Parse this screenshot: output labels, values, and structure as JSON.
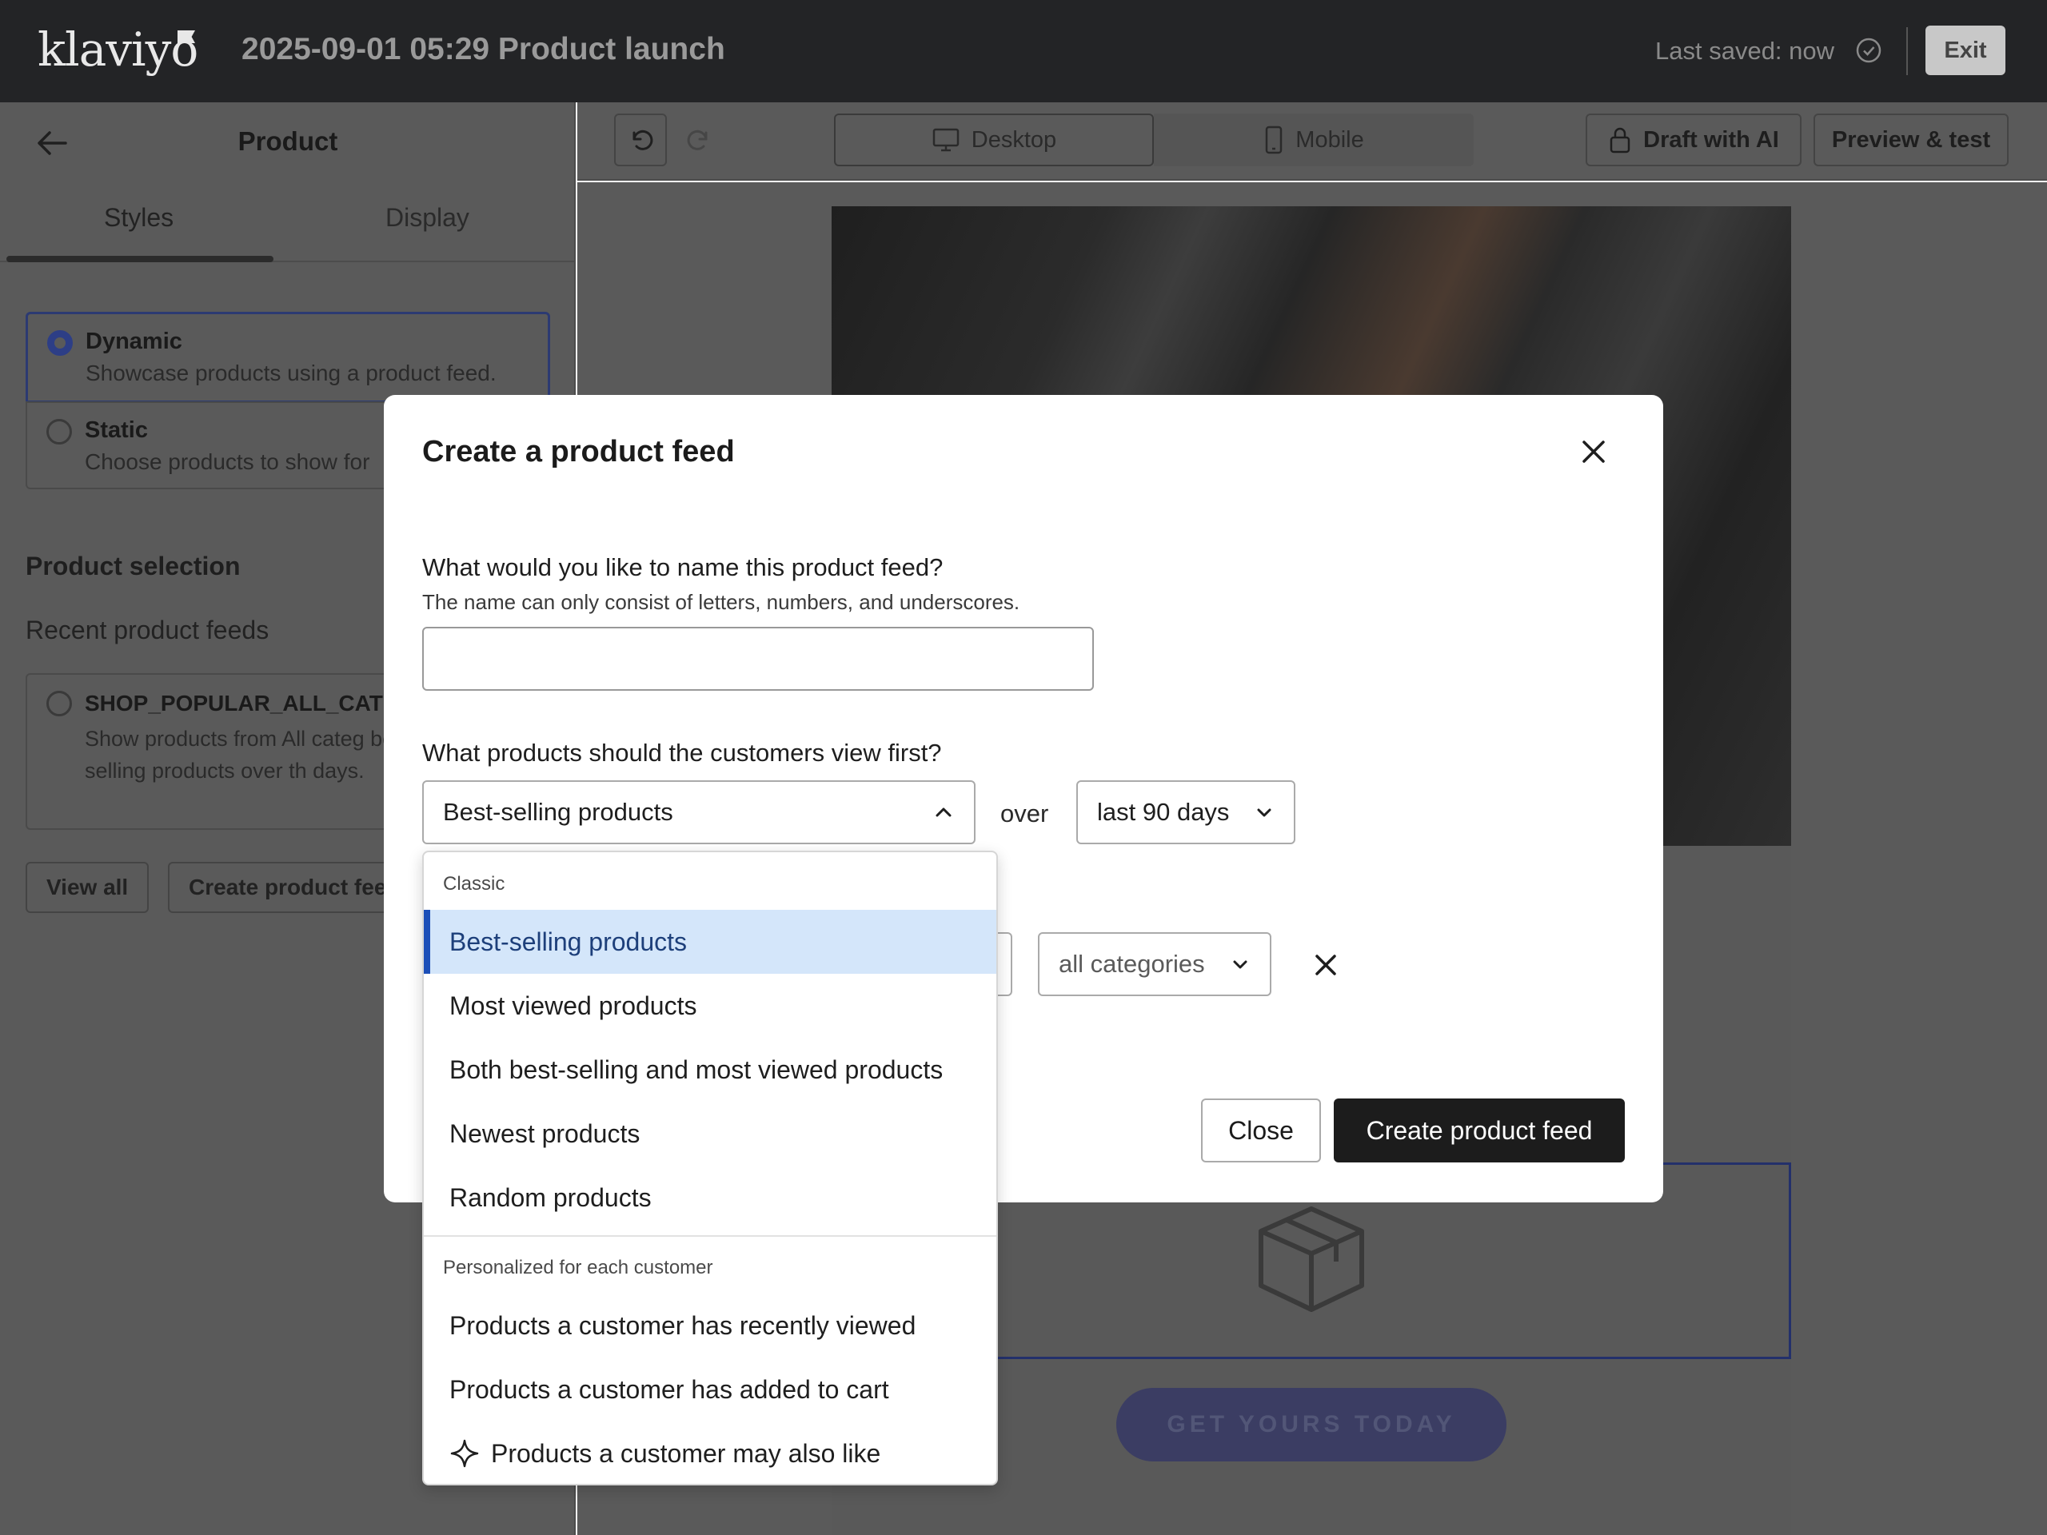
{
  "app": {
    "logo_text": "klaviyo",
    "document_title": "2025-09-01 05:29 Product launch",
    "last_saved": "Last saved: now",
    "exit_label": "Exit"
  },
  "left_panel": {
    "title": "Product",
    "tabs": [
      "Styles",
      "Display"
    ],
    "active_tab": "Styles",
    "options": [
      {
        "title": "Dynamic",
        "desc": "Showcase products using a product feed.",
        "selected": true
      },
      {
        "title": "Static",
        "desc": "Choose products to show for",
        "selected": false
      }
    ],
    "section_title": "Product selection",
    "recent_label": "Recent product feeds",
    "feed_card": {
      "title": "SHOP_POPULAR_ALL_CATE",
      "desc": "Show products from All categ best-selling products over th days."
    },
    "view_all_label": "View all",
    "create_feed_label": "Create product fee"
  },
  "toolbar": {
    "desktop_label": "Desktop",
    "mobile_label": "Mobile",
    "draft_ai_label": "Draft with AI",
    "preview_label": "Preview & test"
  },
  "canvas": {
    "cta_label": "GET YOURS TODAY"
  },
  "modal": {
    "title": "Create a product feed",
    "name_question": "What would you like to name this product feed?",
    "name_help": "The name can only consist of letters, numbers, and underscores.",
    "name_value": "",
    "products_question": "What products should the customers view first?",
    "products_selected": "Best-selling products",
    "over_label": "over",
    "period_selected": "last 90 days",
    "categories_selected": "all categories",
    "close_label": "Close",
    "create_label": "Create product feed"
  },
  "dropdown": {
    "groups": [
      {
        "label": "Classic",
        "items": [
          "Best-selling products",
          "Most viewed products",
          "Both best-selling and most viewed products",
          "Newest products",
          "Random products"
        ]
      },
      {
        "label": "Personalized for each customer",
        "items": [
          "Products a customer has recently viewed",
          "Products a customer has added to cart",
          "Products a customer may also like"
        ]
      }
    ],
    "selected_item": "Best-selling products"
  },
  "colors": {
    "topbar": "#232426",
    "accent_blue": "#1c4fb8",
    "selected_bg": "#d4e6fa",
    "primary_button": "#1c1c1c"
  },
  "icons": [
    "back-arrow-icon",
    "check-circle-icon",
    "undo-icon",
    "redo-icon",
    "desktop-icon",
    "mobile-icon",
    "lock-icon",
    "close-icon",
    "chevron-up-icon",
    "chevron-down-icon",
    "box-icon",
    "sparkle-icon"
  ]
}
